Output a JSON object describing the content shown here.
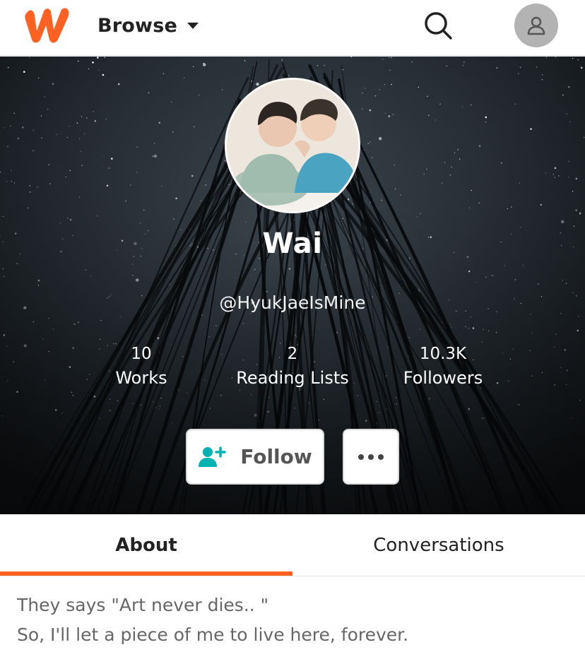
{
  "header": {
    "logo_icon": "wattpad-w-logo",
    "brand_color": "#ff6122",
    "browse_label": "Browse",
    "browse_icon": "caret-down-icon",
    "search_icon": "search-icon",
    "account_icon": "user-avatar-icon"
  },
  "profile": {
    "background": "starry-forest-night",
    "avatar_image": "profile-photo-two-people",
    "display_name": "Wai",
    "handle": "@HyukJaeIsMine",
    "stats": [
      {
        "value": "10",
        "label": "Works"
      },
      {
        "value": "2",
        "label": "Reading Lists"
      },
      {
        "value": "10.3K",
        "label": "Followers"
      }
    ],
    "follow_label": "Follow",
    "follow_icon": "add-user-icon",
    "follow_icon_color": "#00b2b2",
    "more_icon": "more-dots-icon"
  },
  "tabs": [
    {
      "label": "About",
      "active": true
    },
    {
      "label": "Conversations",
      "active": false
    }
  ],
  "about": {
    "line1": "They says  \"Art never dies.. \"",
    "line2": "So, I'll let a piece of me to live here, forever."
  }
}
